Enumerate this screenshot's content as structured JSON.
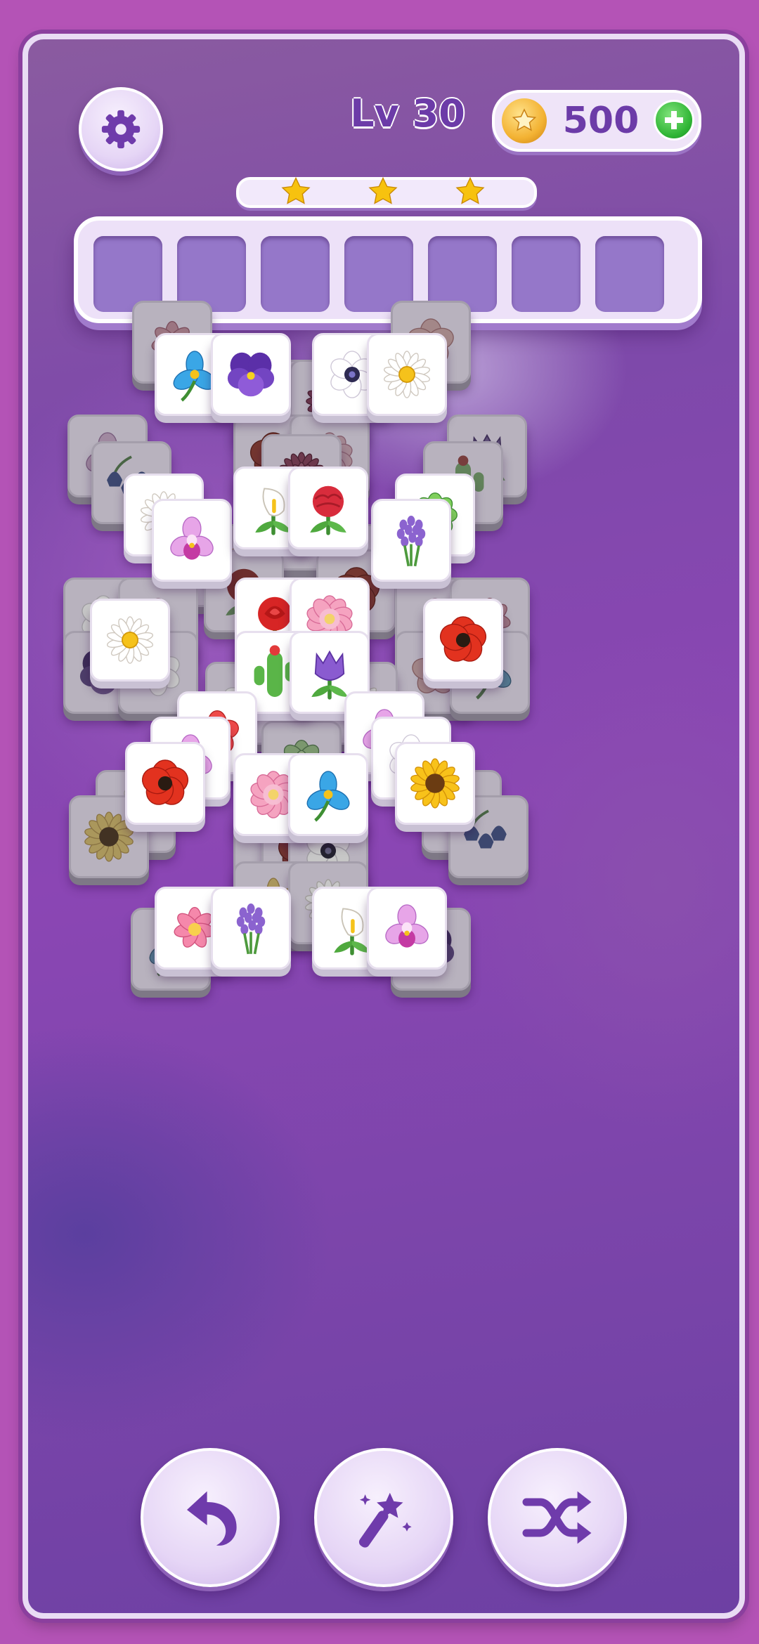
{
  "header": {
    "level_label": "Lv 30",
    "coins": "500",
    "settings_icon": "gear-icon",
    "coin_icon": "coin-star-icon",
    "add_coins_icon": "plus-icon"
  },
  "progress": {
    "fill_fraction": 0.0,
    "stars": 3
  },
  "tray": {
    "slot_count": 7,
    "slots": [
      "",
      "",
      "",
      "",
      "",
      "",
      ""
    ]
  },
  "tiles": [
    {
      "flower": "lotus",
      "z": 0
    },
    {
      "flower": "hibiscus",
      "z": 0
    },
    {
      "flower": "poppy",
      "z": 0
    },
    {
      "flower": "dahlia",
      "z": 0
    },
    {
      "flower": "iris",
      "z": 1
    },
    {
      "flower": "pansy",
      "z": 1
    },
    {
      "flower": "anemone",
      "z": 1
    },
    {
      "flower": "daisy",
      "z": 1
    },
    {
      "flower": "orchid",
      "z": 0
    },
    {
      "flower": "bluebell",
      "z": 0
    },
    {
      "flower": "tulip",
      "z": 0
    },
    {
      "flower": "cactus",
      "z": 0
    },
    {
      "flower": "poppy",
      "z": 0
    },
    {
      "flower": "peony",
      "z": 0
    },
    {
      "flower": "dahlia",
      "z": 0
    },
    {
      "flower": "daisy",
      "z": 1
    },
    {
      "flower": "orchid",
      "z": 1
    },
    {
      "flower": "sunflower",
      "z": 0
    },
    {
      "flower": "succulent",
      "z": 1
    },
    {
      "flower": "lavender",
      "z": 1
    },
    {
      "flower": "lily",
      "z": 0
    },
    {
      "flower": "calla",
      "z": 1
    },
    {
      "flower": "carnation",
      "z": 1
    },
    {
      "flower": "bluebell",
      "z": 0
    },
    {
      "flower": "rose",
      "z": 1
    },
    {
      "flower": "peony",
      "z": 1
    },
    {
      "flower": "cactus",
      "z": 1
    },
    {
      "flower": "tulip",
      "z": 1
    },
    {
      "flower": "rose",
      "z": 0
    },
    {
      "flower": "poppy",
      "z": 0
    },
    {
      "flower": "anemone",
      "z": 0
    },
    {
      "flower": "fuchsia",
      "z": 0
    },
    {
      "flower": "pansy",
      "z": 0
    },
    {
      "flower": "anemone",
      "z": 0
    },
    {
      "flower": "daisy",
      "z": 1
    },
    {
      "flower": "fuchsia",
      "z": 0
    },
    {
      "flower": "lotus",
      "z": 0
    },
    {
      "flower": "hibiscus",
      "z": 0
    },
    {
      "flower": "iris",
      "z": 0
    },
    {
      "flower": "poppy",
      "z": 1
    },
    {
      "flower": "anemone",
      "z": 0
    },
    {
      "flower": "daisy",
      "z": 0
    },
    {
      "flower": "begonia",
      "z": 1
    },
    {
      "flower": "orchid",
      "z": 1
    },
    {
      "flower": "orchid",
      "z": 1
    },
    {
      "flower": "anemone",
      "z": 1
    },
    {
      "flower": "succulent",
      "z": 0
    },
    {
      "flower": "poppy",
      "z": 1
    },
    {
      "flower": "sunflower",
      "z": 1
    },
    {
      "flower": "daisy",
      "z": 0
    },
    {
      "flower": "lily",
      "z": 0
    },
    {
      "flower": "sunflower",
      "z": 0
    },
    {
      "flower": "bluebell",
      "z": 0
    },
    {
      "flower": "peony",
      "z": 1
    },
    {
      "flower": "iris",
      "z": 1
    },
    {
      "flower": "fuchsia",
      "z": 0
    },
    {
      "flower": "poppy",
      "z": 0
    },
    {
      "flower": "anemone",
      "z": 0
    },
    {
      "flower": "lily",
      "z": 0
    },
    {
      "flower": "daisy",
      "z": 0
    },
    {
      "flower": "iris",
      "z": 0
    },
    {
      "flower": "pansy",
      "z": 0
    },
    {
      "flower": "lotus",
      "z": 1
    },
    {
      "flower": "lavender",
      "z": 1
    },
    {
      "flower": "calla",
      "z": 1
    },
    {
      "flower": "orchid",
      "z": 1
    }
  ],
  "bottom_buttons": [
    {
      "name": "undo",
      "icon": "undo-arrow-icon"
    },
    {
      "name": "magic",
      "icon": "magic-wand-icon"
    },
    {
      "name": "shuffle",
      "icon": "shuffle-icon"
    }
  ],
  "colors": {
    "page_bg": "#b453b6",
    "accent_purple": "#6c3ba8",
    "tile_face": "#ffffff",
    "tile_covered": "#b8b2be",
    "slot": "#9577c9",
    "star": "#f7c20f",
    "plus_green": "#2fb535"
  }
}
